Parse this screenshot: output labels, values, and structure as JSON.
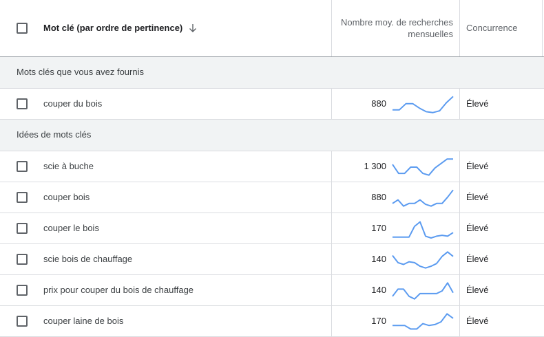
{
  "header": {
    "keyword_col": "Mot clé (par ordre de pertinence)",
    "searches_col_line1": "Nombre moy. de recherches",
    "searches_col_line2": "mensuelles",
    "competition_col": "Concurrence"
  },
  "groups": {
    "provided": "Mots clés que vous avez fournis",
    "ideas": "Idées de mots clés"
  },
  "rows": [
    {
      "keyword": "couper du bois",
      "volume": "880",
      "competition": "Élevé",
      "trend": [
        0.2,
        0.2,
        0.55,
        0.55,
        0.3,
        0.1,
        0.05,
        0.15,
        0.6,
        0.95
      ]
    },
    {
      "keyword": "scie à buche",
      "volume": "1 300",
      "competition": "Élevé",
      "trend": [
        0.65,
        0.15,
        0.15,
        0.5,
        0.5,
        0.15,
        0.05,
        0.45,
        0.7,
        0.95,
        0.95
      ]
    },
    {
      "keyword": "couper bois",
      "volume": "880",
      "competition": "Élevé",
      "trend": [
        0.2,
        0.4,
        0.05,
        0.2,
        0.2,
        0.4,
        0.15,
        0.05,
        0.2,
        0.2,
        0.55,
        0.95
      ]
    },
    {
      "keyword": "couper le bois",
      "volume": "170",
      "competition": "Élevé",
      "trend": [
        0.05,
        0.05,
        0.05,
        0.05,
        0.65,
        0.9,
        0.1,
        0.0,
        0.1,
        0.15,
        0.1,
        0.3
      ]
    },
    {
      "keyword": "scie bois de chauffage",
      "volume": "140",
      "competition": "Élevé",
      "trend": [
        0.75,
        0.35,
        0.25,
        0.4,
        0.35,
        0.15,
        0.05,
        0.15,
        0.3,
        0.7,
        0.95,
        0.7
      ]
    },
    {
      "keyword": "prix pour couper du bois de chauffage",
      "volume": "140",
      "competition": "Élevé",
      "trend": [
        0.2,
        0.6,
        0.6,
        0.2,
        0.05,
        0.35,
        0.35,
        0.35,
        0.35,
        0.5,
        0.95,
        0.4
      ]
    },
    {
      "keyword": "couper laine de bois",
      "volume": "170",
      "competition": "Élevé",
      "trend": [
        0.3,
        0.3,
        0.3,
        0.1,
        0.1,
        0.4,
        0.3,
        0.35,
        0.5,
        0.95,
        0.7
      ]
    }
  ],
  "colors": {
    "trend_line": "#5b9bf0",
    "divider": "#dadce0",
    "group_bg": "#f1f3f4"
  },
  "icons": {
    "sort": "arrow-down-icon",
    "checkbox": "checkbox-icon"
  }
}
